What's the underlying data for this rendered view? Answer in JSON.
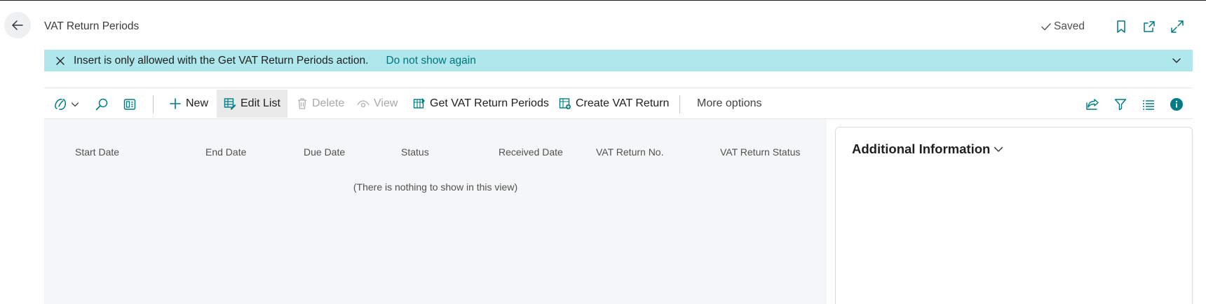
{
  "header": {
    "title": "VAT Return Periods",
    "saved_label": "Saved"
  },
  "banner": {
    "message": "Insert is only allowed with the Get VAT Return Periods action.",
    "link": "Do not show again"
  },
  "actions": {
    "new_label": "New",
    "edit_list_label": "Edit List",
    "delete_label": "Delete",
    "view_label": "View",
    "get_periods_label": "Get VAT Return Periods",
    "create_return_label": "Create VAT Return",
    "more_options_label": "More options"
  },
  "list": {
    "columns": [
      "Start Date",
      "End Date",
      "Due Date",
      "Status",
      "Received Date",
      "VAT Return No.",
      "VAT Return Status"
    ],
    "empty_message": "(There is nothing to show in this view)"
  },
  "factbox": {
    "title": "Additional Information"
  },
  "colors": {
    "banner_bg": "#aee8ec",
    "link": "#00747a",
    "accent": "#007c84"
  }
}
